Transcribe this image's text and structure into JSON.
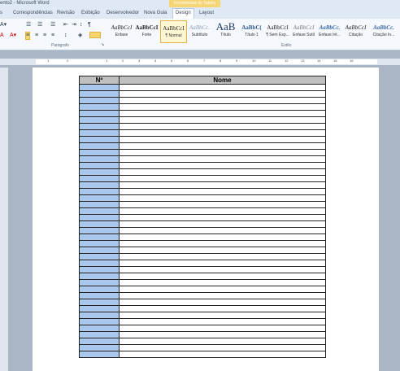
{
  "window": {
    "title": "ento2 - Microsoft Word",
    "contextual_tab": "Ferramentas de Tabela"
  },
  "tabs": [
    {
      "label": "s"
    },
    {
      "label": "Correspondências"
    },
    {
      "label": "Revisão"
    },
    {
      "label": "Exibição"
    },
    {
      "label": "Desenvolvedor"
    },
    {
      "label": "Nova Guia"
    },
    {
      "label": "Design"
    },
    {
      "label": "Layout"
    }
  ],
  "ribbon": {
    "paragraph_label": "Parágrafo",
    "styles_label": "Estilo",
    "styles": [
      {
        "sample": "AaBbCcI",
        "name": "Ênfase"
      },
      {
        "sample": "AaBbCcI",
        "name": "Forte"
      },
      {
        "sample": "AaBbCcI",
        "name": "¶ Normal"
      },
      {
        "sample": "AaBbCc.",
        "name": "Subtítulo"
      },
      {
        "sample": "AaB",
        "name": "Título"
      },
      {
        "sample": "AaBbC(",
        "name": "Título 1"
      },
      {
        "sample": "AaBbCcI",
        "name": "¶ Sem Esp..."
      },
      {
        "sample": "AaBbCcI",
        "name": "Ênfase Sutil"
      },
      {
        "sample": "AaBbCc.",
        "name": "Ênfase Int..."
      },
      {
        "sample": "AaBbCcI",
        "name": "Citação"
      },
      {
        "sample": "AaBbCc.",
        "name": "Citação In..."
      }
    ]
  },
  "ruler_numbers": [
    "1",
    "2",
    "1",
    "2",
    "3",
    "4",
    "5",
    "6",
    "7",
    "8",
    "9",
    "10",
    "11",
    "12",
    "13",
    "14",
    "15",
    "16"
  ],
  "document": {
    "headers": [
      "Nº",
      "Nome"
    ],
    "row_count": 42
  }
}
